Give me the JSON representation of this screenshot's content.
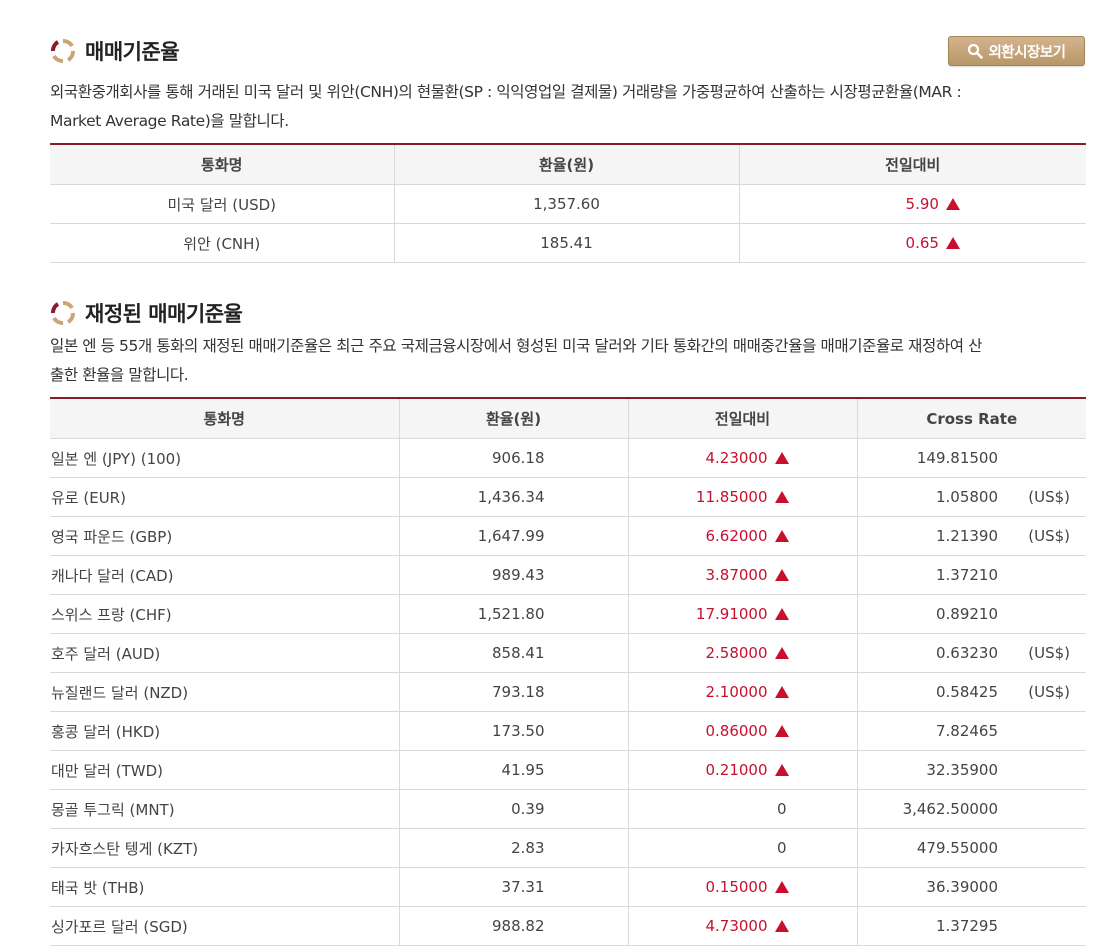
{
  "colors": {
    "accent": "#8b1a2c",
    "up": "#c8102e",
    "button": "#c8a77a"
  },
  "section1": {
    "title": "매매기준율",
    "button_label": "외환시장보기",
    "button_icon": "search-icon",
    "desc_line1": "외국환중개회사를 통해 거래된 미국 달러 및 위안(CNH)의 현물환(SP : 익익영업일 결제물) 거래량을 가중평균하여 산출하는 시장평균환율(MAR :",
    "desc_line2": "Market Average Rate)을 말합니다.",
    "headers": [
      "통화명",
      "환율(원)",
      "전일대비"
    ],
    "rows": [
      {
        "name": "미국 달러 (USD)",
        "rate": "1,357.60",
        "change": "5.90",
        "dir": "up"
      },
      {
        "name": "위안 (CNH)",
        "rate": "185.41",
        "change": "0.65",
        "dir": "up"
      }
    ]
  },
  "section2": {
    "title": "재정된 매매기준율",
    "desc_line1": "일본 엔 등 55개 통화의 재정된 매매기준율은 최근 주요 국제금융시장에서 형성된 미국 달러와 기타 통화간의 매매중간율을 매매기준율로 재정하여 산",
    "desc_line2": "출한 환율을 말합니다.",
    "headers": [
      "통화명",
      "환율(원)",
      "전일대비",
      "Cross Rate"
    ],
    "rows": [
      {
        "name": "일본 엔 (JPY) (100)",
        "rate": "906.18",
        "change": "4.23000",
        "dir": "up",
        "cross": "149.81500",
        "unit": ""
      },
      {
        "name": "유로 (EUR)",
        "rate": "1,436.34",
        "change": "11.85000",
        "dir": "up",
        "cross": "1.05800",
        "unit": "(US$)"
      },
      {
        "name": "영국 파운드 (GBP)",
        "rate": "1,647.99",
        "change": "6.62000",
        "dir": "up",
        "cross": "1.21390",
        "unit": "(US$)"
      },
      {
        "name": "캐나다 달러 (CAD)",
        "rate": "989.43",
        "change": "3.87000",
        "dir": "up",
        "cross": "1.37210",
        "unit": ""
      },
      {
        "name": "스위스 프랑 (CHF)",
        "rate": "1,521.80",
        "change": "17.91000",
        "dir": "up",
        "cross": "0.89210",
        "unit": ""
      },
      {
        "name": "호주 달러 (AUD)",
        "rate": "858.41",
        "change": "2.58000",
        "dir": "up",
        "cross": "0.63230",
        "unit": "(US$)"
      },
      {
        "name": "뉴질랜드 달러 (NZD)",
        "rate": "793.18",
        "change": "2.10000",
        "dir": "up",
        "cross": "0.58425",
        "unit": "(US$)"
      },
      {
        "name": "홍콩 달러 (HKD)",
        "rate": "173.50",
        "change": "0.86000",
        "dir": "up",
        "cross": "7.82465",
        "unit": ""
      },
      {
        "name": "대만 달러 (TWD)",
        "rate": "41.95",
        "change": "0.21000",
        "dir": "up",
        "cross": "32.35900",
        "unit": ""
      },
      {
        "name": "몽골 투그릭 (MNT)",
        "rate": "0.39",
        "change": "0",
        "dir": "flat",
        "cross": "3,462.50000",
        "unit": ""
      },
      {
        "name": "카자흐스탄 텡게 (KZT)",
        "rate": "2.83",
        "change": "0",
        "dir": "flat",
        "cross": "479.55000",
        "unit": ""
      },
      {
        "name": "태국 밧 (THB)",
        "rate": "37.31",
        "change": "0.15000",
        "dir": "up",
        "cross": "36.39000",
        "unit": ""
      },
      {
        "name": "싱가포르 달러 (SGD)",
        "rate": "988.82",
        "change": "4.73000",
        "dir": "up",
        "cross": "1.37295",
        "unit": ""
      }
    ]
  }
}
